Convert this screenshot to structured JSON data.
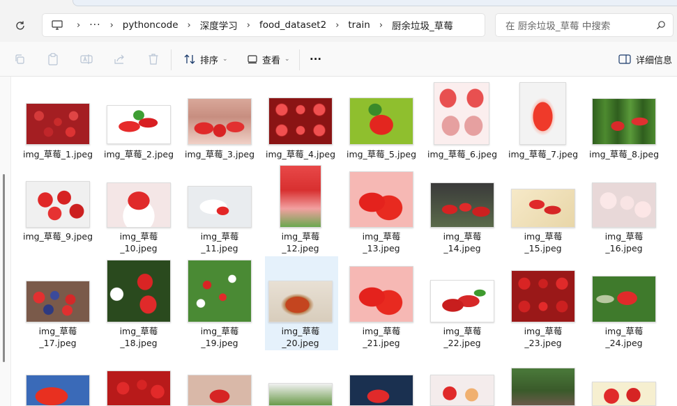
{
  "nav": {
    "breadcrumbs": [
      "pythoncode",
      "深度学习",
      "food_dataset2",
      "train",
      "厨余垃圾_草莓"
    ],
    "more": "···",
    "search_placeholder": "在 厨余垃圾_草莓 中搜索"
  },
  "toolbar": {
    "sort_label": "排序",
    "view_label": "查看",
    "more_label": "···",
    "details_label": "详细信息"
  },
  "files": [
    {
      "line1": "img_草莓_1.jpeg",
      "line2": ""
    },
    {
      "line1": "img_草莓_2.jpeg",
      "line2": ""
    },
    {
      "line1": "img_草莓_3.jpeg",
      "line2": ""
    },
    {
      "line1": "img_草莓_4.jpeg",
      "line2": ""
    },
    {
      "line1": "img_草莓_5.jpeg",
      "line2": ""
    },
    {
      "line1": "img_草莓_6.jpeg",
      "line2": ""
    },
    {
      "line1": "img_草莓_7.jpeg",
      "line2": ""
    },
    {
      "line1": "img_草莓_8.jpeg",
      "line2": ""
    },
    {
      "line1": "img_草莓_9.jpeg",
      "line2": ""
    },
    {
      "line1": "img_草莓",
      "line2": "_10.jpeg"
    },
    {
      "line1": "img_草莓",
      "line2": "_11.jpeg"
    },
    {
      "line1": "img_草莓",
      "line2": "_12.jpeg"
    },
    {
      "line1": "img_草莓",
      "line2": "_13.jpeg"
    },
    {
      "line1": "img_草莓",
      "line2": "_14.jpeg"
    },
    {
      "line1": "img_草莓",
      "line2": "_15.jpeg"
    },
    {
      "line1": "img_草莓",
      "line2": "_16.jpeg"
    },
    {
      "line1": "img_草莓",
      "line2": "_17.jpeg"
    },
    {
      "line1": "img_草莓",
      "line2": "_18.jpeg"
    },
    {
      "line1": "img_草莓",
      "line2": "_19.jpeg"
    },
    {
      "line1": "img_草莓",
      "line2": "_20.jpeg"
    },
    {
      "line1": "img_草莓",
      "line2": "_21.jpeg"
    },
    {
      "line1": "img_草莓",
      "line2": "_22.jpeg"
    },
    {
      "line1": "img_草莓",
      "line2": "_23.jpeg"
    },
    {
      "line1": "img_草莓",
      "line2": "_24.jpeg"
    }
  ],
  "colors": {
    "selection": "#e5f1fb",
    "accent": "#0067c0",
    "strawberry": "#d7262e"
  }
}
